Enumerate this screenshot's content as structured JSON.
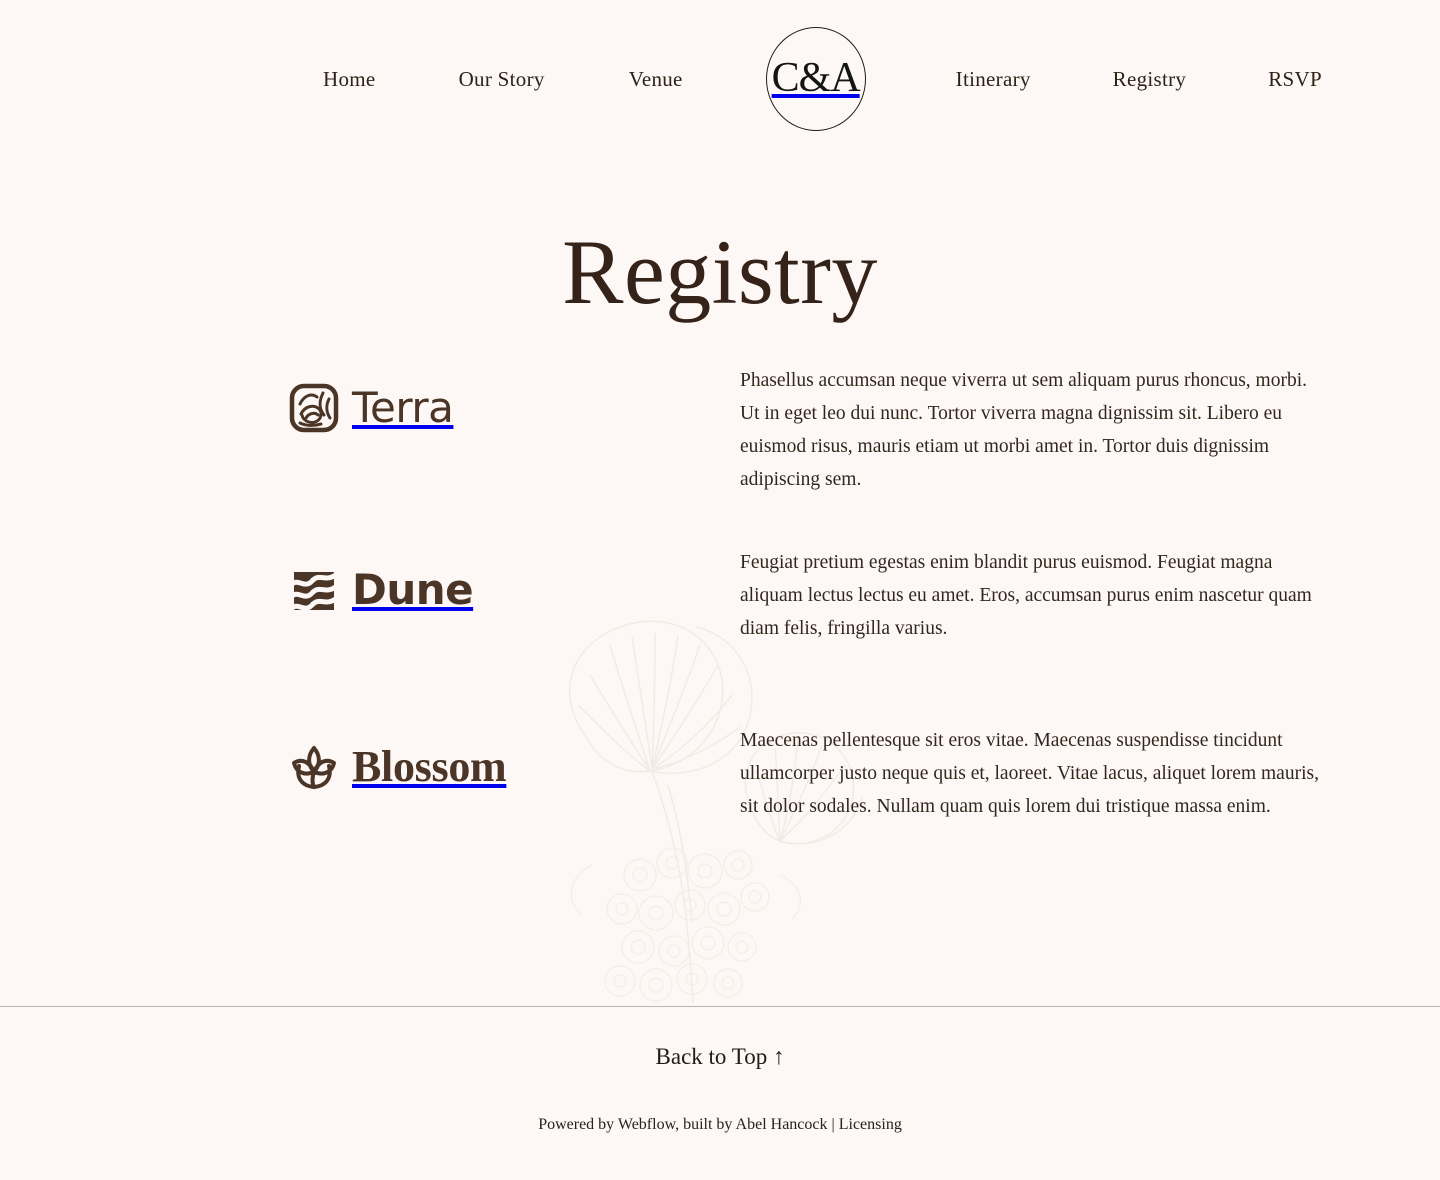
{
  "site": {
    "background_color": "#fdf8f5",
    "brand_color": "#4a3527",
    "text_color": "#2e2118"
  },
  "nav": {
    "left_links": [
      {
        "label": "Home"
      },
      {
        "label": "Our Story"
      },
      {
        "label": "Venue"
      }
    ],
    "logo": {
      "monogram": "C&A",
      "icon": "monogram-circle-logo"
    },
    "right_links": [
      {
        "label": "Itinerary"
      },
      {
        "label": "Registry"
      },
      {
        "label": "RSVP"
      }
    ]
  },
  "page": {
    "title": "Registry"
  },
  "registry": {
    "items": [
      {
        "name": "Terra",
        "icon": "terra-leaf-square-icon",
        "description": "Phasellus accumsan neque viverra ut sem aliquam purus rhoncus, morbi. Ut in eget leo dui nunc. Tortor viverra magna dignissim sit. Libero eu euismod risus, mauris etiam ut morbi amet in. Tortor duis dignissim adipiscing sem."
      },
      {
        "name": "Dune",
        "icon": "dune-wave-square-icon",
        "description": "Feugiat pretium egestas enim blandit purus euismod. Feugiat magna aliquam lectus lectus eu amet. Eros, accumsan purus enim nascetur quam diam felis, fringilla varius."
      },
      {
        "name": "Blossom",
        "icon": "blossom-lotus-icon",
        "description": "Maecenas pellentesque sit eros vitae. Maecenas suspendisse tincidunt ullamcorper justo neque quis et, laoreet. Vitae lacus, aliquet lorem mauris, sit dolor sodales. Nullam quam quis lorem dui tristique massa enim."
      }
    ]
  },
  "footer": {
    "back_to_top": "Back to Top ↑",
    "colophon_prefix": "Powered by Webflow, built by Abel Hancock | ",
    "colophon_link": "Licensing"
  }
}
